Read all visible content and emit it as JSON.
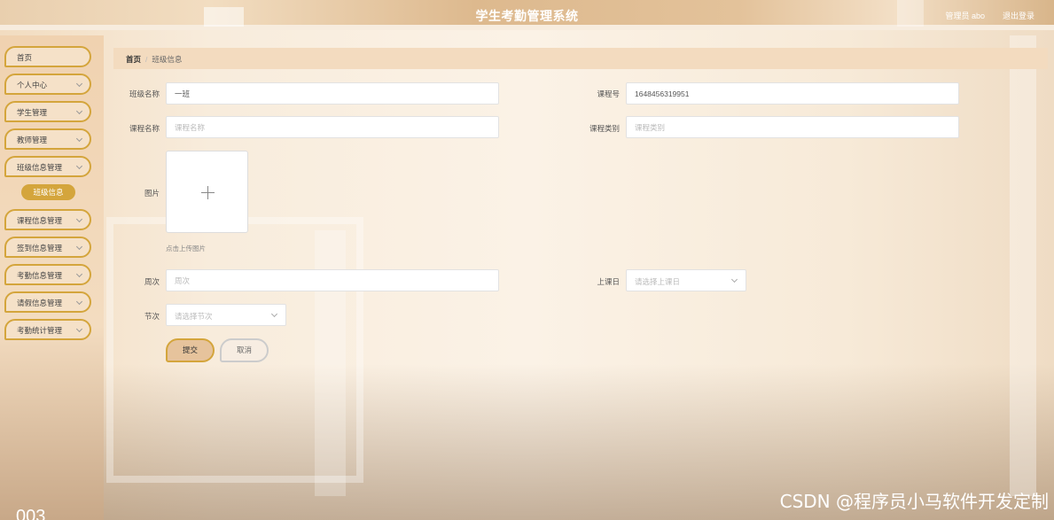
{
  "header": {
    "title": "学生考勤管理系统",
    "user_text": "管理员 abo",
    "logout": "退出登录"
  },
  "sidebar": {
    "items": [
      {
        "label": "首页"
      },
      {
        "label": "个人中心"
      },
      {
        "label": "学生管理"
      },
      {
        "label": "教师管理"
      },
      {
        "label": "班级信息管理"
      },
      {
        "label": "课程信息管理"
      },
      {
        "label": "签到信息管理"
      },
      {
        "label": "考勤信息管理"
      },
      {
        "label": "请假信息管理"
      },
      {
        "label": "考勤统计管理"
      }
    ],
    "sub_item": "班级信息"
  },
  "breadcrumb": {
    "home": "首页",
    "current": "班级信息"
  },
  "form": {
    "class_name": {
      "label": "班级名称",
      "value": "一班"
    },
    "course_no": {
      "label": "课程号",
      "value": "1648456319951"
    },
    "course_name": {
      "label": "课程名称",
      "placeholder": "课程名称"
    },
    "course_type": {
      "label": "课程类别",
      "placeholder": "课程类别"
    },
    "image": {
      "label": "图片",
      "hint": "点击上传图片"
    },
    "week": {
      "label": "周次",
      "placeholder": "周次"
    },
    "class_day": {
      "label": "上课日",
      "placeholder": "请选择上课日"
    },
    "section": {
      "label": "节次",
      "placeholder": "请选择节次"
    },
    "submit": "提交",
    "cancel": "取消"
  },
  "watermark": "CSDN @程序员小马软件开发定制",
  "corner_text": "003"
}
